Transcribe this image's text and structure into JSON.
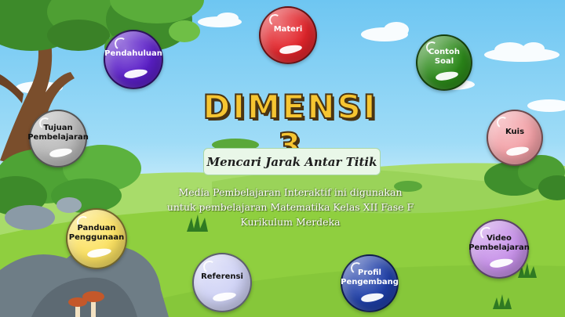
{
  "title": "DIMENSI 3",
  "subtitle": "Mencari Jarak Antar Titik",
  "description": [
    "Media Pembelajaran Interaktif ini digunakan",
    "untuk pembelajaran Matematika Kelas XII Fase F",
    "Kurikulum Merdeka"
  ],
  "menu": {
    "materi": {
      "label": "Materi",
      "color": "#e2252b",
      "text_color": "#ffffff"
    },
    "pendahuluan": {
      "label": "Pendahuluan",
      "color": "#5b1fc8",
      "text_color": "#ffffff"
    },
    "contoh_soal": {
      "label": "Contoh Soal",
      "color": "#2c8a1a",
      "text_color": "#ffffff"
    },
    "tujuan": {
      "label": "Tujuan Pembelajaran",
      "color": "#b9b9b9",
      "text_color": "#111111"
    },
    "kuis": {
      "label": "Kuis",
      "color": "#f2a0a6",
      "text_color": "#111111"
    },
    "panduan": {
      "label": "Panduan Penggunaan",
      "color": "#fbe162",
      "text_color": "#111111"
    },
    "video": {
      "label": "Video Pembelajaran",
      "color": "#c690e8",
      "text_color": "#111111"
    },
    "referensi": {
      "label": "Referensi",
      "color": "#cfd2f5",
      "text_color": "#111111"
    },
    "profil": {
      "label": "Profil Pengembang",
      "color": "#1f3fa8",
      "text_color": "#ffffff"
    }
  },
  "colors": {
    "title_fill": "#f6c531",
    "title_outline": "#4a3413",
    "sky": "#6ec6f2",
    "grass": "#8fcf3f"
  }
}
